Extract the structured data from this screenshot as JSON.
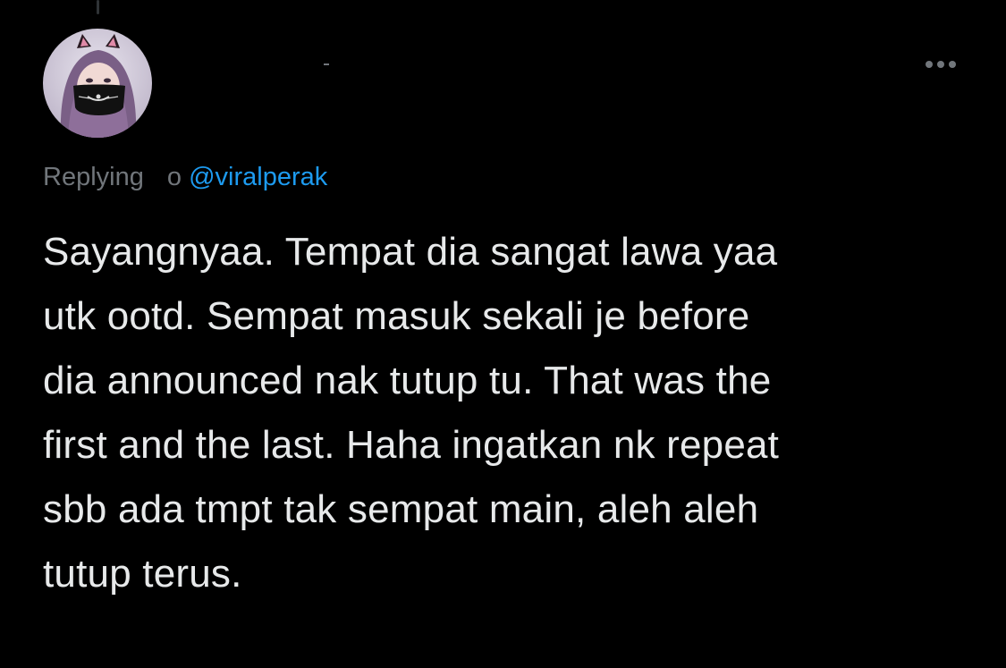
{
  "tweet": {
    "avatar_icon": "user-avatar",
    "more_icon": "more-options-icon",
    "reply": {
      "prefix": "Replying",
      "connector": "o",
      "mention": "@viralperak"
    },
    "text_lines": [
      "Sayangnyaa. Tempat dia sangat lawa yaa",
      "utk ootd. Sempat masuk sekali je before",
      "dia announced nak tutup tu. That was the",
      "first and the last. Haha ingatkan nk repeat",
      "sbb ada tmpt tak sempat main, aleh aleh",
      "tutup terus."
    ]
  },
  "colors": {
    "background": "#000000",
    "text": "#e7e9ea",
    "muted": "#71767b",
    "link": "#1d9bf0"
  }
}
